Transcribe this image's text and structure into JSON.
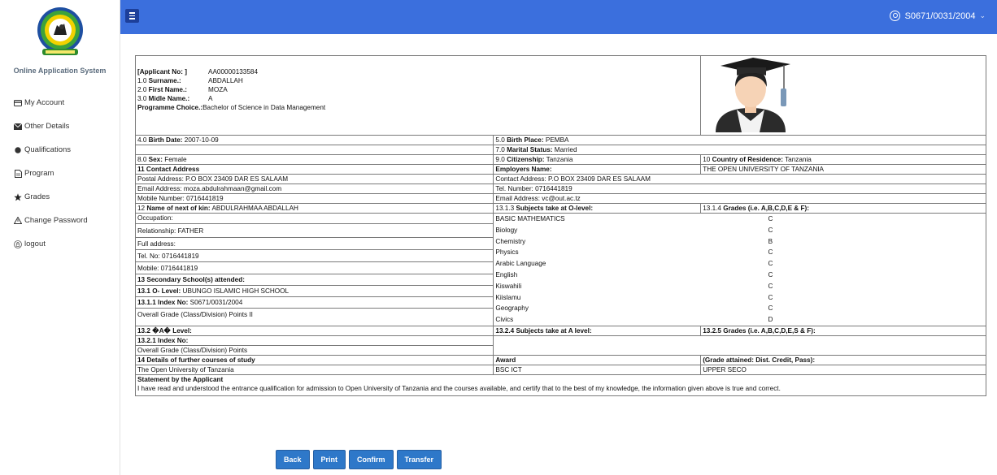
{
  "sidebar": {
    "app_title": "Online Application System",
    "items": [
      {
        "label": "My Account",
        "icon": "credit-card-icon"
      },
      {
        "label": "Other Details",
        "icon": "envelope-icon"
      },
      {
        "label": "Qualifications",
        "icon": "circle-icon"
      },
      {
        "label": "Program",
        "icon": "document-icon"
      },
      {
        "label": "Grades",
        "icon": "star-icon"
      },
      {
        "label": "Change Password",
        "icon": "warning-icon"
      },
      {
        "label": "logout",
        "icon": "lock-icon"
      }
    ]
  },
  "topbar": {
    "username": "S0671/0031/2004",
    "color": "#3b6fdd"
  },
  "header": {
    "applicant_no_label": "[Applicant No: ]",
    "applicant_no": "AA00000133584",
    "surname_label_num": "1.0",
    "surname_label": "Surname.:",
    "surname": "ABDALLAH",
    "first_name_label_num": "2.0",
    "first_name_label": "First Name.:",
    "first_name": "MOZA",
    "middle_name_label_num": "3.0",
    "middle_name_label": "Midle Name.:",
    "middle_name": "A",
    "programme_label": "Programme Choice.:",
    "programme": "Bachelor of Science in Data Management"
  },
  "details": {
    "birth_date_label": "4.0 ",
    "birth_date_bold": "Birth Date:",
    "birth_date": " 2007-10-09",
    "birth_place_label": "5.0 ",
    "birth_place_bold": "Birth Place:",
    "birth_place": " PEMBA",
    "marital_label": "7.0 ",
    "marital_bold": "Marital Status:",
    "marital": " Married",
    "sex_label": "8.0 ",
    "sex_bold": "Sex:",
    "sex": " Female",
    "citizenship_label": "9.0 ",
    "citizenship_bold": "Citizenship:",
    "citizenship": " Tanzania",
    "residence_label": "10 ",
    "residence_bold": "Country of Residence:",
    "residence": " Tanzania",
    "contact_header": "11 Contact Address",
    "employers_label": "Employers Name:",
    "employers": "THE OPEN UNIVERSITY OF TANZANIA",
    "postal": "Postal Address: P.O BOX 23409 DAR ES SALAAM",
    "contact_address": "Contact Address: P.O BOX 23409 DAR ES SALAAM",
    "email": "Email Address: moza.abdulrahmaan@gmail.com",
    "tel": "Tel. Number: 0716441819",
    "mobile": "Mobile Number: 0716441819",
    "emp_email": "Email Address: vc@out.ac.tz",
    "kin_label": "12 ",
    "kin_bold": "Name of next of kin:",
    "kin": " ABDULRAHMAA ABDALLAH",
    "olevel_subjects_label": "13.1.3 ",
    "olevel_subjects_bold": "Subjects take at O-level:",
    "olevel_grades_label": "13.1.4 ",
    "olevel_grades_bold": "Grades (i.e. A,B,C,D,E & F):",
    "kin_lines": [
      "Occupation:",
      "Relationship: FATHER",
      "Full address:",
      "Tel. No: 0716441819",
      "Mobile: 0716441819"
    ],
    "secondary_label": "13 Secondary School(s) attended:",
    "olevel_label": "13.1 O- Level:",
    "olevel": " UBUNGO ISLAMIC HIGH SCHOOL",
    "index_label": "13.1.1 Index No:",
    "index": " S0671/0031/2004",
    "overall_grade": "Overall Grade (Class/Division) Points II",
    "subjects": [
      {
        "name": "BASIC MATHEMATICS",
        "grade": "C"
      },
      {
        "name": "Biology",
        "grade": "C"
      },
      {
        "name": "Chemistry",
        "grade": "B"
      },
      {
        "name": "Physics",
        "grade": "C"
      },
      {
        "name": "Arabic Language",
        "grade": "C"
      },
      {
        "name": "English",
        "grade": "C"
      },
      {
        "name": "Kiswahili",
        "grade": "C"
      },
      {
        "name": "Kiislamu",
        "grade": "C"
      },
      {
        "name": "Geography",
        "grade": "C"
      },
      {
        "name": "Civics",
        "grade": "D"
      }
    ],
    "alevel_label": "13.2 �A� Level:",
    "alevel_subjects_label": "13.2.4 Subjects take at A level:",
    "alevel_grades_label": "13.2.5 Grades (i.e. A,B,C,D,E,S & F):",
    "alevel_index_label": "13.2.1 Index No:",
    "alevel_overall": "Overall Grade (Class/Division) Points",
    "further_label": "14 Details of further courses of study",
    "award_label": "Award",
    "grade_attained_label": "(Grade attained: Dist. Credit, Pass):",
    "further_institution": "The Open University of Tanzania",
    "further_award": "BSC ICT",
    "further_grade": "UPPER SECO",
    "statement_title": "Statement by the Applicant",
    "statement_text": "I have read and understood the entrance qualification for admission to Open University of Tanzania and the courses available, and certify that to the best of my knowledge, the information given above is true and correct."
  },
  "buttons": {
    "back": "Back",
    "print": "Print",
    "confirm": "Confirm",
    "transfer": "Transfer"
  }
}
